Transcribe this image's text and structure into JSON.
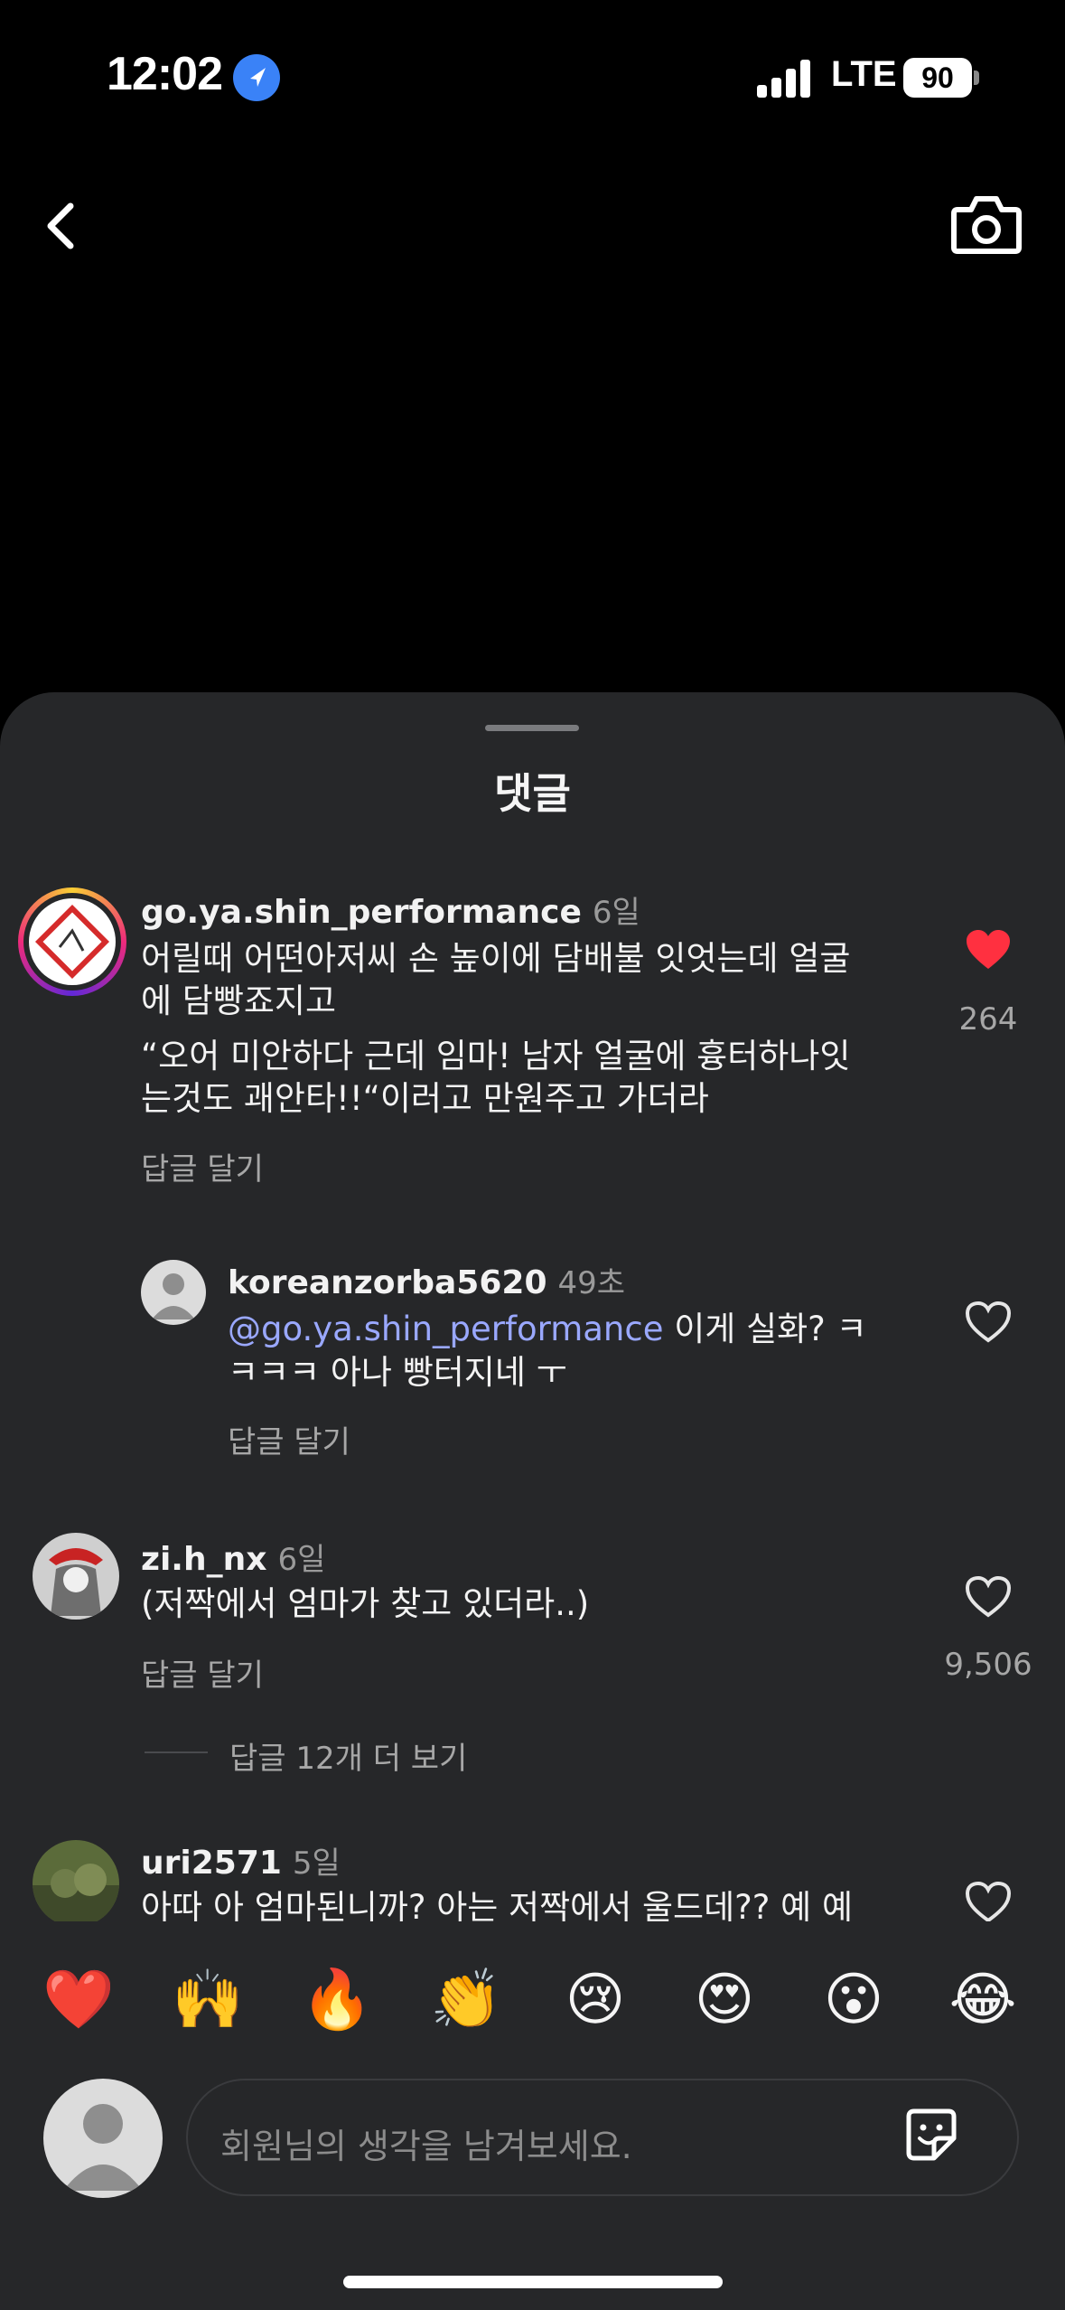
{
  "status_bar": {
    "time": "12:02",
    "network": "LTE",
    "battery": "90"
  },
  "sheet": {
    "title": "댓글"
  },
  "comments": [
    {
      "username": "go.ya.shin_performance",
      "time": "6일",
      "lines": [
        "어릴때 어떤아저씨 손 높이에 담배불 잇엇는데 얼굴",
        "에 담빵죠지고",
        "“오어 미안하다 근데 임마! 남자 얼굴에 흉터하나잇",
        "는것도 괘안타!!“이러고 만원주고 가더라"
      ],
      "reply_label": "답글 달기",
      "likes": "264",
      "liked": true
    },
    {
      "username": "koreanzorba5620",
      "time": "49초",
      "mention": "@go.ya.shin_performance",
      "line1_rest": " 이게 실화? ㅋ",
      "line2": "ㅋㅋㅋ 아나 빵터지네 ㅜ",
      "reply_label": "답글 달기"
    },
    {
      "username": "zi.h_nx",
      "time": "6일",
      "lines": [
        "(저짝에서 엄마가 찾고 있더라..)"
      ],
      "reply_label": "답글 달기",
      "likes": "9,506",
      "more_replies": "답글 12개 더 보기"
    },
    {
      "username": "uri2571",
      "time": "5일",
      "lines": [
        "아따 아 엄마된니까? 아는 저짝에서 울드데?? 예 예"
      ]
    }
  ],
  "emoji_bar": [
    "❤️",
    "🙌",
    "🔥",
    "👏",
    "😢",
    "😍",
    "😮",
    "😂"
  ],
  "input": {
    "placeholder": "회원님의 생각을 남겨보세요."
  },
  "colors": {
    "sheet_bg": "#262729",
    "like_red": "#ff3040",
    "mention": "#9aa8ff",
    "location_blue": "#3a82f7"
  },
  "icons": [
    "location-arrow-icon",
    "signal-icon",
    "battery-icon",
    "back-chevron-icon",
    "camera-icon",
    "heart-icon",
    "sticker-icon"
  ]
}
